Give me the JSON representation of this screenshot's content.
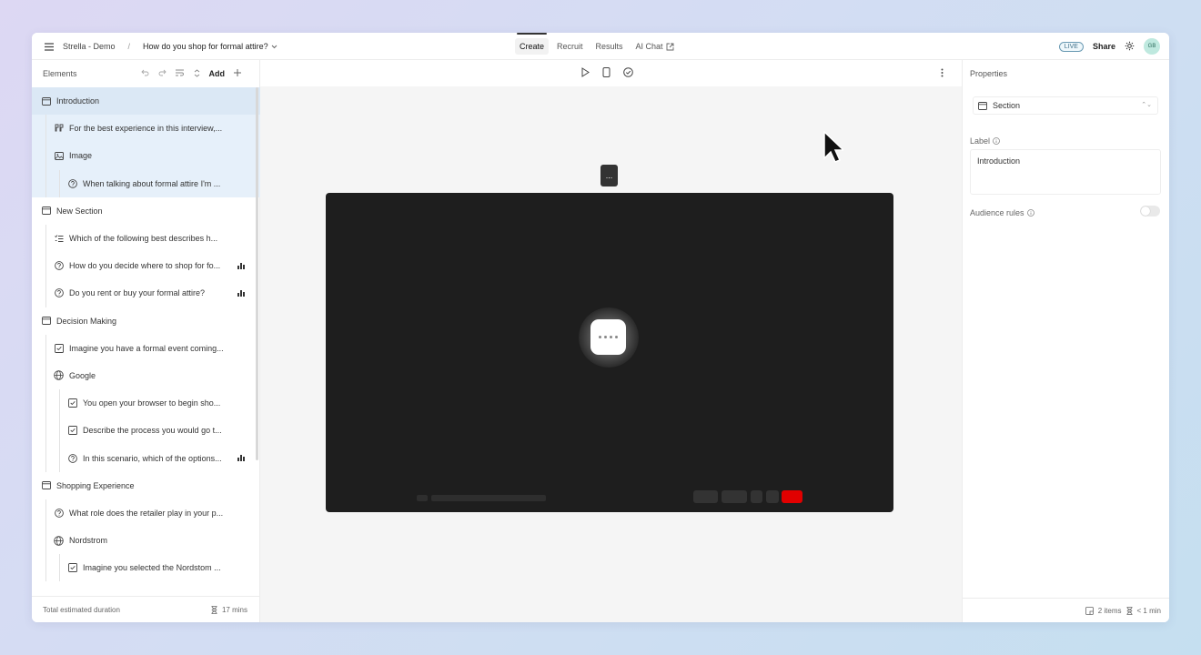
{
  "topbar": {
    "project": "Strella - Demo",
    "separator": "/",
    "study_title": "How do you shop for formal attire?",
    "tabs": [
      {
        "label": "Create",
        "active": true
      },
      {
        "label": "Recruit"
      },
      {
        "label": "Results"
      },
      {
        "label": "AI Chat"
      }
    ],
    "live_badge": "LIVE",
    "share_label": "Share",
    "avatar_initials": "GB"
  },
  "elements_panel": {
    "title": "Elements",
    "add_label": "Add",
    "items": [
      {
        "level": 0,
        "icon": "section-icon",
        "label": "Introduction",
        "selected": true
      },
      {
        "level": 1,
        "icon": "quote-icon",
        "label": "For the best experience in this interview,..."
      },
      {
        "level": 1,
        "icon": "image-icon",
        "label": "Image"
      },
      {
        "level": 2,
        "icon": "question-icon",
        "label": "When talking about formal attire I'm ..."
      },
      {
        "level": 0,
        "icon": "section-icon",
        "label": "New Section"
      },
      {
        "level": 1,
        "icon": "list-icon",
        "label": "Which of the following best describes h..."
      },
      {
        "level": 1,
        "icon": "question-icon",
        "label": "How do you decide where to shop for fo...",
        "chart": true
      },
      {
        "level": 1,
        "icon": "question-icon",
        "label": "Do you rent or buy your formal attire?",
        "chart": true
      },
      {
        "level": 0,
        "icon": "section-icon",
        "label": "Decision Making"
      },
      {
        "level": 1,
        "icon": "task-icon",
        "label": "Imagine you have a formal event coming..."
      },
      {
        "level": 1,
        "icon": "globe-icon",
        "label": "Google"
      },
      {
        "level": 2,
        "icon": "task-icon",
        "label": "You open your browser to begin sho..."
      },
      {
        "level": 2,
        "icon": "task-icon",
        "label": "Describe the process you would go t..."
      },
      {
        "level": 2,
        "icon": "question-icon",
        "label": "In this scenario, which of the options...",
        "chart": true
      },
      {
        "level": 0,
        "icon": "section-icon",
        "label": "Shopping Experience"
      },
      {
        "level": 1,
        "icon": "question-icon",
        "label": "What role does the retailer play in your p..."
      },
      {
        "level": 1,
        "icon": "globe-icon",
        "label": "Nordstrom"
      },
      {
        "level": 2,
        "icon": "task-icon",
        "label": "Imagine you selected the Nordstom ..."
      }
    ],
    "footer_label": "Total estimated duration",
    "footer_duration": "17 mins"
  },
  "canvas": {
    "floating_button": "...",
    "loading": true
  },
  "properties": {
    "title": "Properties",
    "type_value": "Section",
    "label_title": "Label",
    "label_value": "Introduction",
    "audience_rules_label": "Audience rules",
    "audience_rules_enabled": false,
    "footer_items": "2 items",
    "footer_duration": "< 1 min"
  },
  "colors": {
    "selected_row": "#dbe8f5",
    "selected_children": "#e6f0fa",
    "video_bg": "#1e1e1e",
    "record_red": "#e10000"
  }
}
